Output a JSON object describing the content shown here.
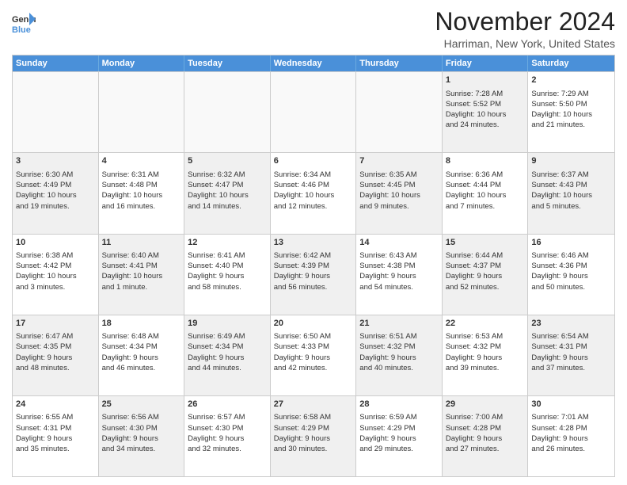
{
  "logo": {
    "general": "General",
    "blue": "Blue"
  },
  "header": {
    "month": "November 2024",
    "location": "Harriman, New York, United States"
  },
  "days": [
    "Sunday",
    "Monday",
    "Tuesday",
    "Wednesday",
    "Thursday",
    "Friday",
    "Saturday"
  ],
  "weeks": [
    [
      {
        "day": "",
        "empty": true
      },
      {
        "day": "",
        "empty": true
      },
      {
        "day": "",
        "empty": true
      },
      {
        "day": "",
        "empty": true
      },
      {
        "day": "",
        "empty": true
      },
      {
        "day": "1",
        "line1": "Sunrise: 7:28 AM",
        "line2": "Sunset: 5:52 PM",
        "line3": "Daylight: 10 hours",
        "line4": "and 24 minutes.",
        "shaded": true
      },
      {
        "day": "2",
        "line1": "Sunrise: 7:29 AM",
        "line2": "Sunset: 5:50 PM",
        "line3": "Daylight: 10 hours",
        "line4": "and 21 minutes.",
        "shaded": false
      }
    ],
    [
      {
        "day": "3",
        "line1": "Sunrise: 6:30 AM",
        "line2": "Sunset: 4:49 PM",
        "line3": "Daylight: 10 hours",
        "line4": "and 19 minutes.",
        "shaded": true
      },
      {
        "day": "4",
        "line1": "Sunrise: 6:31 AM",
        "line2": "Sunset: 4:48 PM",
        "line3": "Daylight: 10 hours",
        "line4": "and 16 minutes.",
        "shaded": false
      },
      {
        "day": "5",
        "line1": "Sunrise: 6:32 AM",
        "line2": "Sunset: 4:47 PM",
        "line3": "Daylight: 10 hours",
        "line4": "and 14 minutes.",
        "shaded": true
      },
      {
        "day": "6",
        "line1": "Sunrise: 6:34 AM",
        "line2": "Sunset: 4:46 PM",
        "line3": "Daylight: 10 hours",
        "line4": "and 12 minutes.",
        "shaded": false
      },
      {
        "day": "7",
        "line1": "Sunrise: 6:35 AM",
        "line2": "Sunset: 4:45 PM",
        "line3": "Daylight: 10 hours",
        "line4": "and 9 minutes.",
        "shaded": true
      },
      {
        "day": "8",
        "line1": "Sunrise: 6:36 AM",
        "line2": "Sunset: 4:44 PM",
        "line3": "Daylight: 10 hours",
        "line4": "and 7 minutes.",
        "shaded": false
      },
      {
        "day": "9",
        "line1": "Sunrise: 6:37 AM",
        "line2": "Sunset: 4:43 PM",
        "line3": "Daylight: 10 hours",
        "line4": "and 5 minutes.",
        "shaded": true
      }
    ],
    [
      {
        "day": "10",
        "line1": "Sunrise: 6:38 AM",
        "line2": "Sunset: 4:42 PM",
        "line3": "Daylight: 10 hours",
        "line4": "and 3 minutes.",
        "shaded": false
      },
      {
        "day": "11",
        "line1": "Sunrise: 6:40 AM",
        "line2": "Sunset: 4:41 PM",
        "line3": "Daylight: 10 hours",
        "line4": "and 1 minute.",
        "shaded": true
      },
      {
        "day": "12",
        "line1": "Sunrise: 6:41 AM",
        "line2": "Sunset: 4:40 PM",
        "line3": "Daylight: 9 hours",
        "line4": "and 58 minutes.",
        "shaded": false
      },
      {
        "day": "13",
        "line1": "Sunrise: 6:42 AM",
        "line2": "Sunset: 4:39 PM",
        "line3": "Daylight: 9 hours",
        "line4": "and 56 minutes.",
        "shaded": true
      },
      {
        "day": "14",
        "line1": "Sunrise: 6:43 AM",
        "line2": "Sunset: 4:38 PM",
        "line3": "Daylight: 9 hours",
        "line4": "and 54 minutes.",
        "shaded": false
      },
      {
        "day": "15",
        "line1": "Sunrise: 6:44 AM",
        "line2": "Sunset: 4:37 PM",
        "line3": "Daylight: 9 hours",
        "line4": "and 52 minutes.",
        "shaded": true
      },
      {
        "day": "16",
        "line1": "Sunrise: 6:46 AM",
        "line2": "Sunset: 4:36 PM",
        "line3": "Daylight: 9 hours",
        "line4": "and 50 minutes.",
        "shaded": false
      }
    ],
    [
      {
        "day": "17",
        "line1": "Sunrise: 6:47 AM",
        "line2": "Sunset: 4:35 PM",
        "line3": "Daylight: 9 hours",
        "line4": "and 48 minutes.",
        "shaded": true
      },
      {
        "day": "18",
        "line1": "Sunrise: 6:48 AM",
        "line2": "Sunset: 4:34 PM",
        "line3": "Daylight: 9 hours",
        "line4": "and 46 minutes.",
        "shaded": false
      },
      {
        "day": "19",
        "line1": "Sunrise: 6:49 AM",
        "line2": "Sunset: 4:34 PM",
        "line3": "Daylight: 9 hours",
        "line4": "and 44 minutes.",
        "shaded": true
      },
      {
        "day": "20",
        "line1": "Sunrise: 6:50 AM",
        "line2": "Sunset: 4:33 PM",
        "line3": "Daylight: 9 hours",
        "line4": "and 42 minutes.",
        "shaded": false
      },
      {
        "day": "21",
        "line1": "Sunrise: 6:51 AM",
        "line2": "Sunset: 4:32 PM",
        "line3": "Daylight: 9 hours",
        "line4": "and 40 minutes.",
        "shaded": true
      },
      {
        "day": "22",
        "line1": "Sunrise: 6:53 AM",
        "line2": "Sunset: 4:32 PM",
        "line3": "Daylight: 9 hours",
        "line4": "and 39 minutes.",
        "shaded": false
      },
      {
        "day": "23",
        "line1": "Sunrise: 6:54 AM",
        "line2": "Sunset: 4:31 PM",
        "line3": "Daylight: 9 hours",
        "line4": "and 37 minutes.",
        "shaded": true
      }
    ],
    [
      {
        "day": "24",
        "line1": "Sunrise: 6:55 AM",
        "line2": "Sunset: 4:31 PM",
        "line3": "Daylight: 9 hours",
        "line4": "and 35 minutes.",
        "shaded": false
      },
      {
        "day": "25",
        "line1": "Sunrise: 6:56 AM",
        "line2": "Sunset: 4:30 PM",
        "line3": "Daylight: 9 hours",
        "line4": "and 34 minutes.",
        "shaded": true
      },
      {
        "day": "26",
        "line1": "Sunrise: 6:57 AM",
        "line2": "Sunset: 4:30 PM",
        "line3": "Daylight: 9 hours",
        "line4": "and 32 minutes.",
        "shaded": false
      },
      {
        "day": "27",
        "line1": "Sunrise: 6:58 AM",
        "line2": "Sunset: 4:29 PM",
        "line3": "Daylight: 9 hours",
        "line4": "and 30 minutes.",
        "shaded": true
      },
      {
        "day": "28",
        "line1": "Sunrise: 6:59 AM",
        "line2": "Sunset: 4:29 PM",
        "line3": "Daylight: 9 hours",
        "line4": "and 29 minutes.",
        "shaded": false
      },
      {
        "day": "29",
        "line1": "Sunrise: 7:00 AM",
        "line2": "Sunset: 4:28 PM",
        "line3": "Daylight: 9 hours",
        "line4": "and 27 minutes.",
        "shaded": true
      },
      {
        "day": "30",
        "line1": "Sunrise: 7:01 AM",
        "line2": "Sunset: 4:28 PM",
        "line3": "Daylight: 9 hours",
        "line4": "and 26 minutes.",
        "shaded": false
      }
    ]
  ]
}
